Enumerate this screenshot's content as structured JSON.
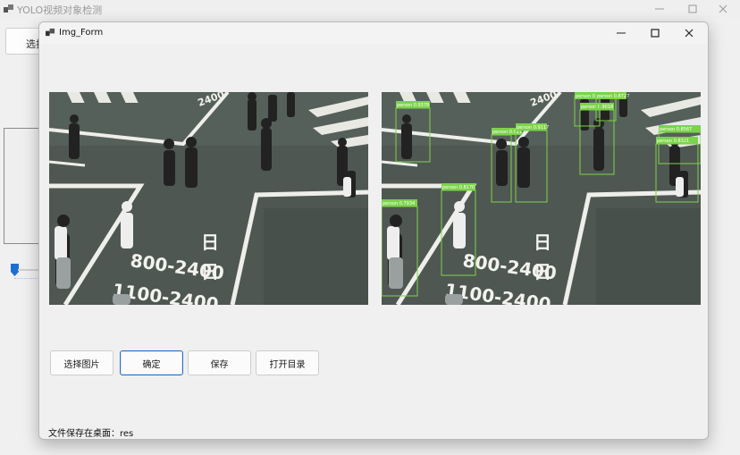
{
  "main_window": {
    "title": "YOLO视频对象检测",
    "select_button_label": "选择"
  },
  "dialog": {
    "title": "Img_Form",
    "buttons": {
      "select_image": "选择图片",
      "confirm": "确定",
      "save": "保存",
      "open_directory": "打开目录"
    },
    "status_text": "文件保存在桌面：res"
  },
  "road_markings": {
    "kanji": "日",
    "time_top": "800-2400",
    "time_bottom": "1100-2400",
    "top_marking": "2400"
  },
  "detections": [
    {
      "label": "person 0.9378"
    },
    {
      "label": "person 0.9212"
    },
    {
      "label": "person 0.9117"
    },
    {
      "label": "person 0.9018"
    },
    {
      "label": "person 0.8865"
    },
    {
      "label": "person 0.8727"
    },
    {
      "label": "person 0.8567"
    },
    {
      "label": "person 0.8321"
    },
    {
      "label": "person 0.8170"
    },
    {
      "label": "person 0.7934"
    }
  ],
  "colors": {
    "detection_box": "#7cd34a",
    "asphalt": "#4f5752",
    "road_line": "#eeeeea"
  }
}
